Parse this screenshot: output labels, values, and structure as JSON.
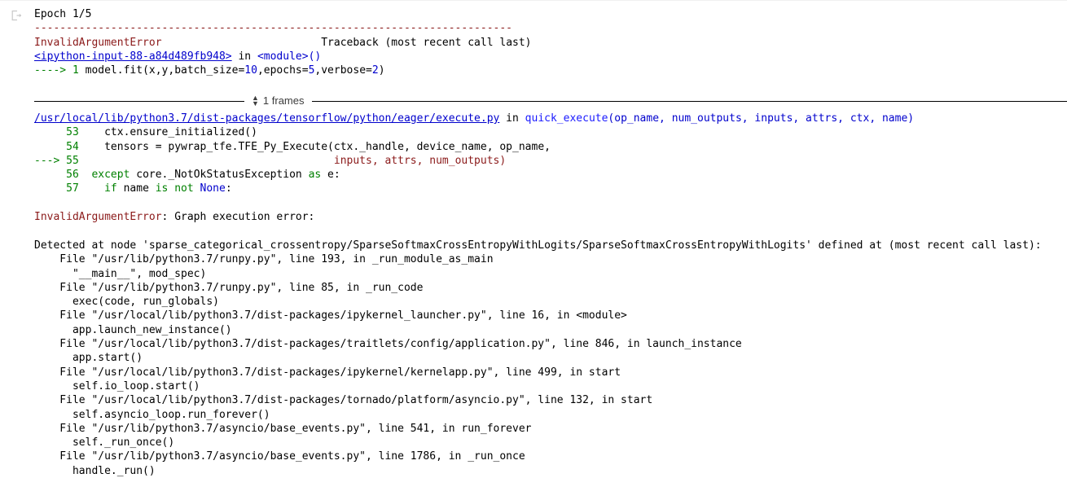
{
  "notebook": {
    "gutter_icon": "output-cell-icon",
    "frames_toggle": {
      "label": "1 frames",
      "up_glyph": "▲",
      "down_glyph": "▼"
    }
  },
  "colors": {
    "error_red": "#8b1a1a",
    "link_blue": "#0000cd",
    "keyword_green": "#008000",
    "function_blue": "#1a1aff",
    "background": "#ffffff"
  },
  "output": {
    "epoch": "Epoch 1/5",
    "dashes": "---------------------------------------------------------------------------",
    "error_name": "InvalidArgumentError",
    "traceback_header": "Traceback (most recent call last)",
    "input_link": "<ipython-input-88-a84d489fb948>",
    "input_in": " in ",
    "input_module": "<module>()",
    "call_arrow": "----> 1 ",
    "call_code_a": "model.fit(x,y,batch_size=",
    "call_num_1": "10",
    "call_code_b": ",epochs=",
    "call_num_2": "5",
    "call_code_c": ",verbose=",
    "call_num_3": "2",
    "call_code_d": ")"
  },
  "frame": {
    "file_link": "/usr/local/lib/python3.7/dist-packages/tensorflow/python/eager/execute.py",
    "in_word": " in ",
    "func_name": "quick_execute",
    "func_args": "(op_name, num_outputs, inputs, attrs, ctx, name)",
    "lines": [
      {
        "marker": "     ",
        "no": "53",
        "code": "    ctx.ensure_initialized()",
        "style": "plain"
      },
      {
        "marker": "     ",
        "no": "54",
        "code": "    tensors = pywrap_tfe.TFE_Py_Execute(ctx._handle, device_name, op_name,",
        "style": "plain"
      },
      {
        "marker": "---> ",
        "no": "55",
        "code": "                                        inputs, attrs, num_outputs)",
        "style": "error"
      },
      {
        "marker": "     ",
        "no": "56",
        "code": "  except core._NotOkStatusException as e:",
        "style": "keyword"
      },
      {
        "marker": "     ",
        "no": "57",
        "code": "    if name is not None:",
        "style": "keyword"
      }
    ]
  },
  "message": {
    "error_name": "InvalidArgumentError",
    "text": ": Graph execution error:"
  },
  "detected": {
    "text": "Detected at node 'sparse_categorical_crossentropy/SparseSoftmaxCrossEntropyWithLogits/SparseSoftmaxCrossEntropyWithLogits' defined at (most recent call last):"
  },
  "stack": [
    {
      "file": "    File \"/usr/lib/python3.7/runpy.py\", line 193, in _run_module_as_main",
      "code": "      \"__main__\", mod_spec)"
    },
    {
      "file": "    File \"/usr/lib/python3.7/runpy.py\", line 85, in _run_code",
      "code": "      exec(code, run_globals)"
    },
    {
      "file": "    File \"/usr/local/lib/python3.7/dist-packages/ipykernel_launcher.py\", line 16, in <module>",
      "code": "      app.launch_new_instance()"
    },
    {
      "file": "    File \"/usr/local/lib/python3.7/dist-packages/traitlets/config/application.py\", line 846, in launch_instance",
      "code": "      app.start()"
    },
    {
      "file": "    File \"/usr/local/lib/python3.7/dist-packages/ipykernel/kernelapp.py\", line 499, in start",
      "code": "      self.io_loop.start()"
    },
    {
      "file": "    File \"/usr/local/lib/python3.7/dist-packages/tornado/platform/asyncio.py\", line 132, in start",
      "code": "      self.asyncio_loop.run_forever()"
    },
    {
      "file": "    File \"/usr/lib/python3.7/asyncio/base_events.py\", line 541, in run_forever",
      "code": "      self._run_once()"
    },
    {
      "file": "    File \"/usr/lib/python3.7/asyncio/base_events.py\", line 1786, in _run_once",
      "code": "      handle._run()"
    }
  ]
}
